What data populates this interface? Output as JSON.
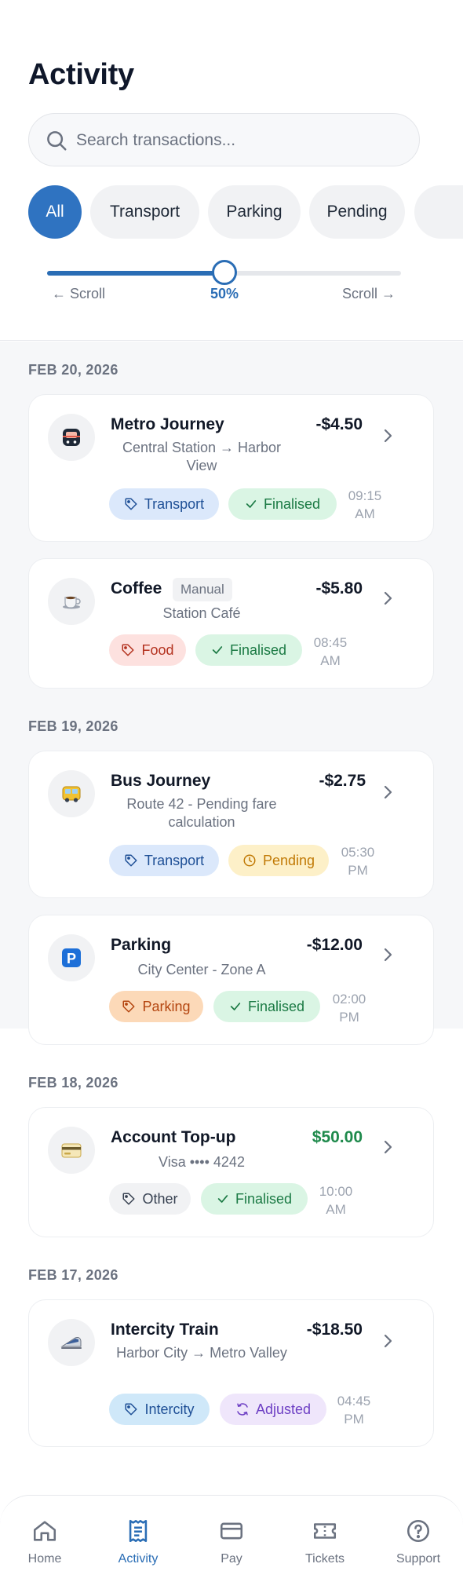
{
  "page": {
    "title": "Activity"
  },
  "search": {
    "placeholder": "Search transactions..."
  },
  "filters": [
    {
      "label": "All",
      "active": true
    },
    {
      "label": "Transport",
      "active": false
    },
    {
      "label": "Parking",
      "active": false
    },
    {
      "label": "Pending",
      "active": false
    },
    {
      "label": "",
      "active": false
    }
  ],
  "scroll": {
    "left_label": "← Scroll",
    "percent_label": "50%",
    "right_label": "Scroll →",
    "position": 0.5
  },
  "groups": [
    {
      "date": "FEB 20, 2026",
      "items": [
        {
          "title": "Metro Journey",
          "amount": "-$4.50",
          "positive": false,
          "sub": "Central Station → Harbor View",
          "category": "Transport",
          "status": "Finalised",
          "time": "09:15 AM",
          "icon": "metro-icon",
          "manual": ""
        },
        {
          "title": "Coffee",
          "amount": "-$5.80",
          "positive": false,
          "sub": "Station Café",
          "category": "Food",
          "status": "Finalised",
          "time": "08:45 AM",
          "icon": "coffee-icon",
          "manual": "Manual"
        }
      ]
    },
    {
      "date": "FEB 19, 2026",
      "items": [
        {
          "title": "Bus Journey",
          "amount": "-$2.75",
          "positive": false,
          "sub": "Route 42 - Pending fare calculation",
          "category": "Transport",
          "status": "Pending",
          "time": "05:30 PM",
          "icon": "bus-icon",
          "manual": ""
        },
        {
          "title": "Parking",
          "amount": "-$12.00",
          "positive": false,
          "sub": "City Center - Zone A",
          "category": "Parking",
          "status": "Finalised",
          "time": "02:00 PM",
          "icon": "parking-icon",
          "manual": ""
        }
      ]
    },
    {
      "date": "FEB 18, 2026",
      "items": [
        {
          "title": "Account Top-up",
          "amount": "$50.00",
          "positive": true,
          "sub": "Visa •••• 4242",
          "category": "Other",
          "status": "Finalised",
          "time": "10:00 AM",
          "icon": "credit-card-icon",
          "manual": ""
        }
      ]
    },
    {
      "date": "FEB 17, 2026",
      "items": [
        {
          "title": "Intercity Train",
          "amount": "-$18.50",
          "positive": false,
          "sub": "Harbor City → Metro Valley",
          "category": "Intercity",
          "status": "Adjusted",
          "time": "04:45 PM",
          "icon": "train-icon",
          "manual": ""
        }
      ]
    }
  ],
  "nav": [
    {
      "label": "Home",
      "icon": "home-icon",
      "active": false
    },
    {
      "label": "Activity",
      "icon": "receipt-icon",
      "active": true
    },
    {
      "label": "Pay",
      "icon": "card-icon",
      "active": false
    },
    {
      "label": "Tickets",
      "icon": "ticket-icon",
      "active": false
    },
    {
      "label": "Support",
      "icon": "help-icon",
      "active": false
    }
  ],
  "colors": {
    "accent": "#2a6db5",
    "transport_bg": "#dbe8fb",
    "transport_fg": "#1e4f96",
    "food_bg": "#fde1df",
    "food_fg": "#b4321f",
    "parking_bg": "#fcd9b8",
    "parking_fg": "#b4450f",
    "other_bg": "#f1f2f4",
    "other_fg": "#374151",
    "intercity_bg": "#cfe8f9",
    "intercity_fg": "#1e4f96",
    "finalised_bg": "#daf5e4",
    "finalised_fg": "#1b7a44",
    "pending_bg": "#fdf0c8",
    "pending_fg": "#c17a06",
    "adjusted_bg": "#efe6fb",
    "adjusted_fg": "#6d3fc4",
    "positive_amount": "#1f8a4c"
  }
}
